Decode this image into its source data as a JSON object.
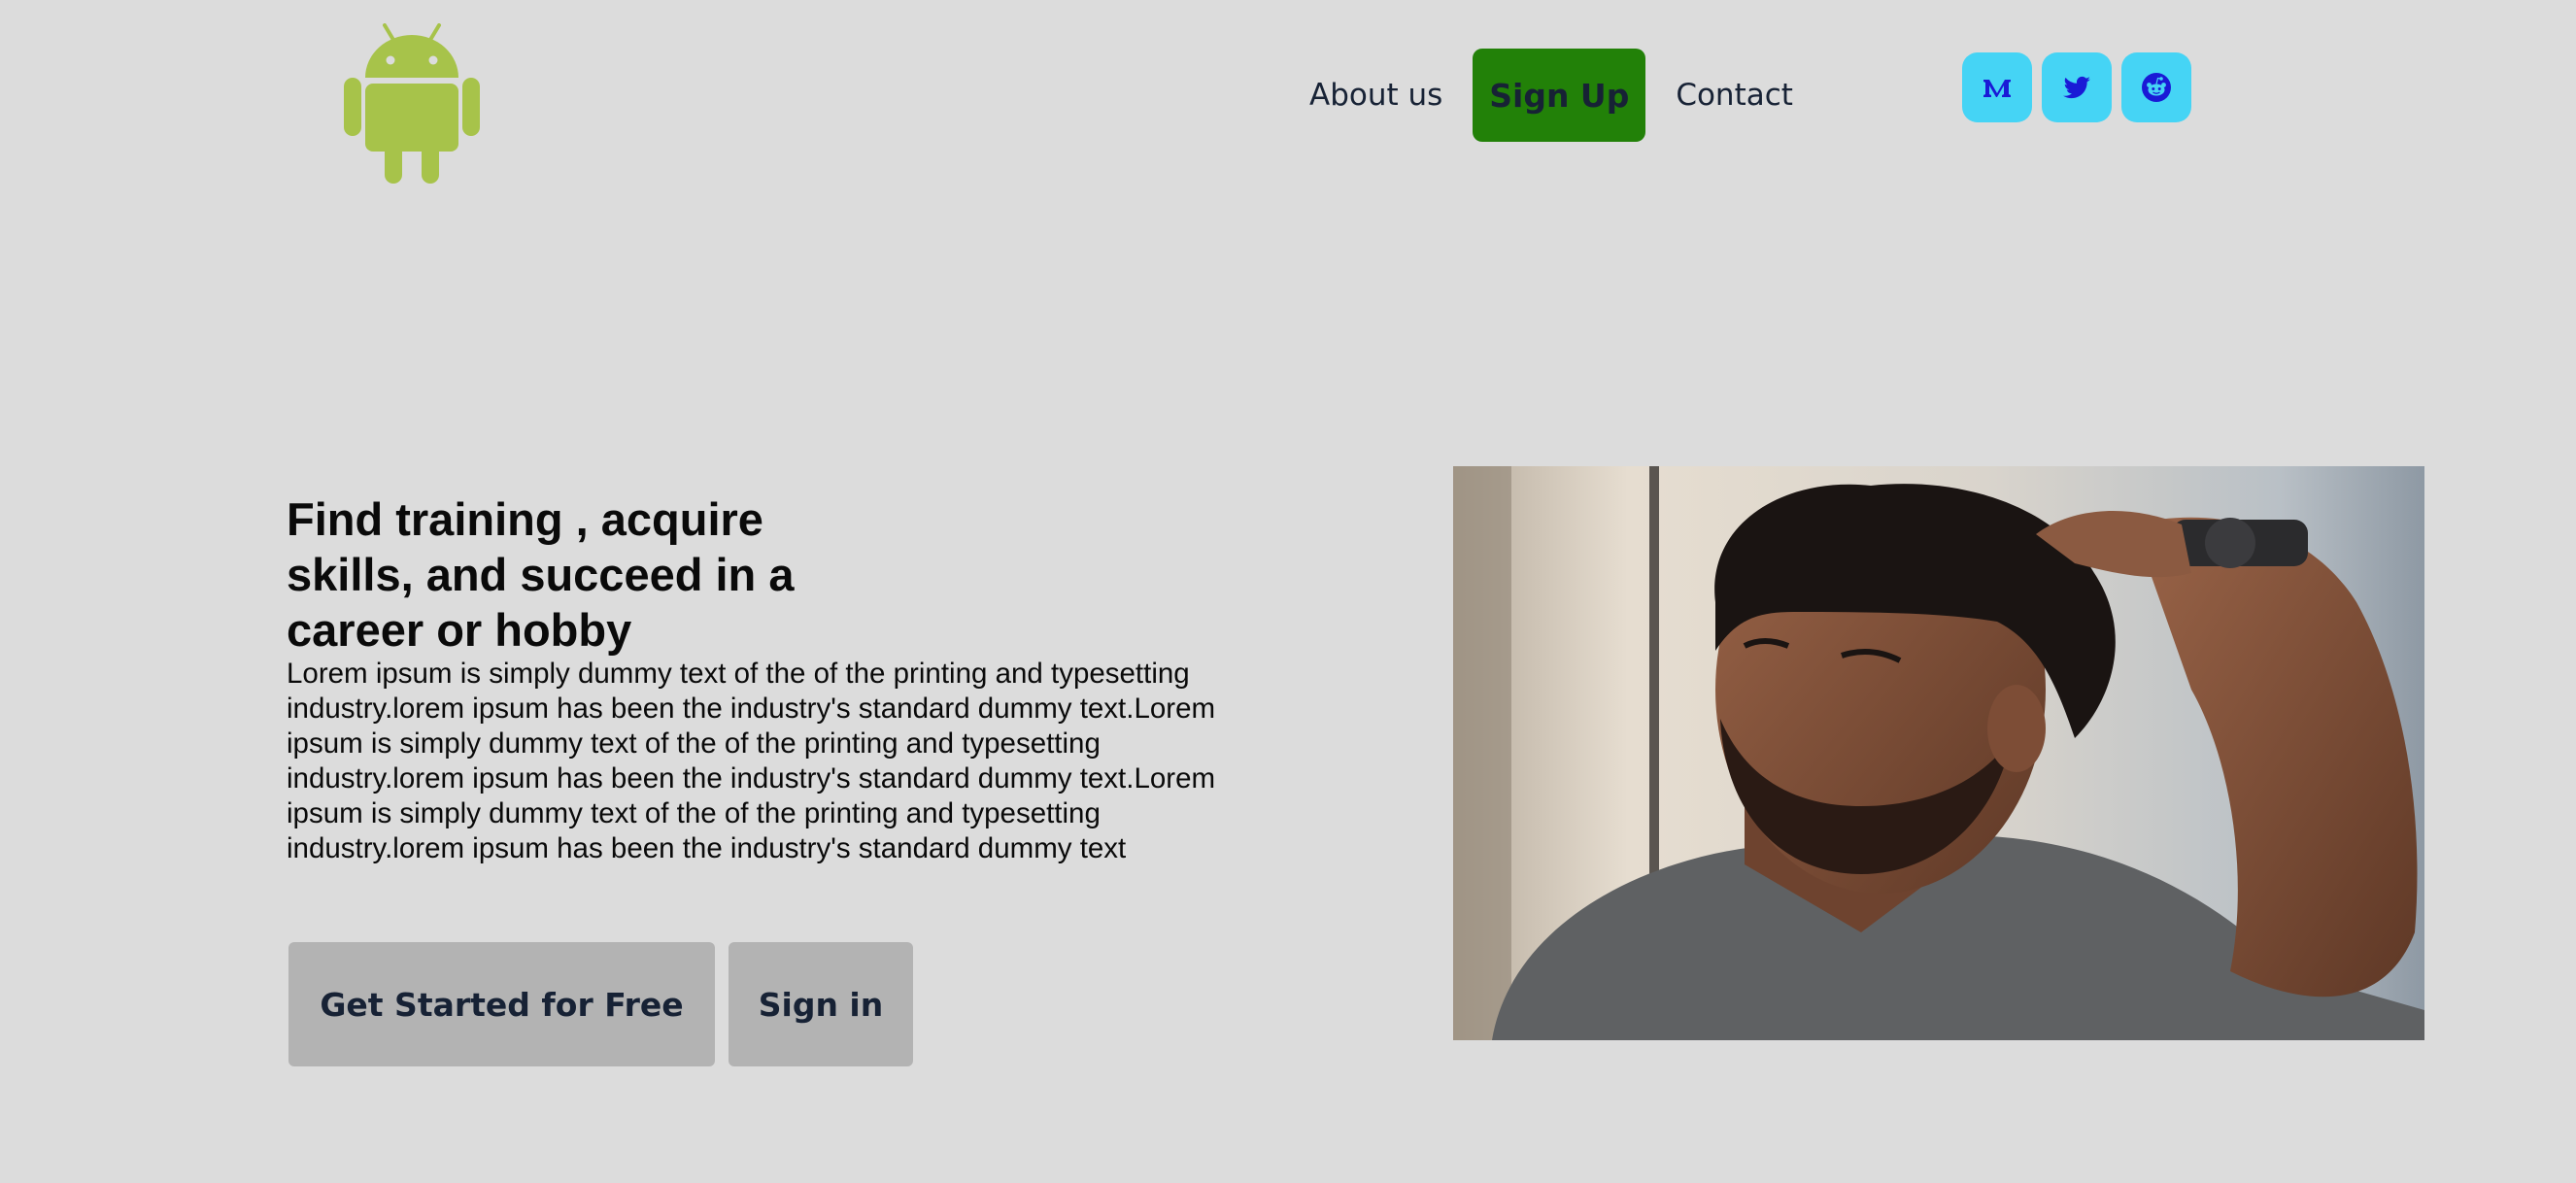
{
  "header": {
    "logo_icon": "android-icon",
    "nav": {
      "about": "About us",
      "signup": "Sign Up",
      "contact": "Contact"
    },
    "socials": [
      {
        "icon": "medium-icon"
      },
      {
        "icon": "twitter-icon"
      },
      {
        "icon": "reddit-icon"
      }
    ]
  },
  "hero": {
    "title": "Find training , acquire skills, and succeed in a career or hobby",
    "body": "Lorem ipsum is simply dummy text of the of the printing and typesetting industry.lorem ipsum has been the industry's standard dummy text.Lorem ipsum is simply dummy text of the of the printing and typesetting industry.lorem ipsum has been the industry's standard dummy text.Lorem ipsum is simply dummy text of the of the printing and typesetting industry.lorem ipsum has been the industry's standard dummy text",
    "cta_primary": "Get Started for Free",
    "cta_secondary": "Sign in"
  },
  "colors": {
    "background": "#dcdcdc",
    "signup_bg": "#228108",
    "social_bg": "#45d4f5",
    "social_fg": "#1a1ad6",
    "button_bg": "#b3b3b3",
    "android_green": "#a4c639"
  }
}
